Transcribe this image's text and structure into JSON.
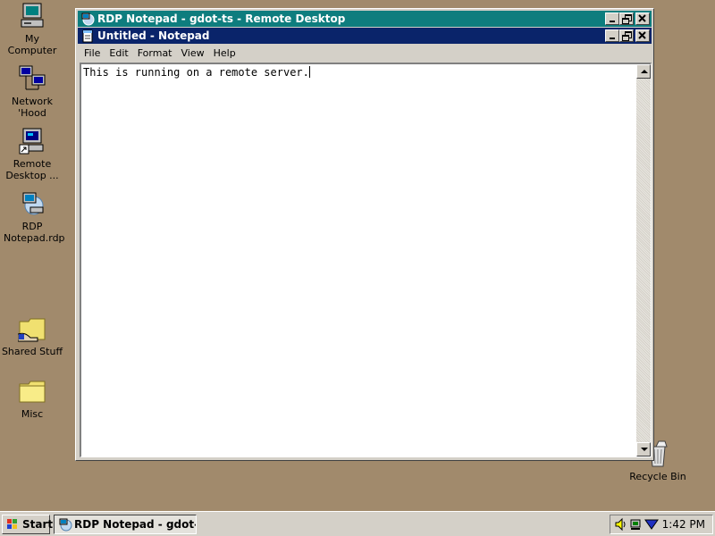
{
  "desktop": {
    "icons": [
      {
        "label": "My Computer",
        "icon": "computer-icon"
      },
      {
        "label": "Network 'Hood",
        "icon": "network-icon"
      },
      {
        "label": "Remote Desktop ...",
        "icon": "remote-desktop-icon"
      },
      {
        "label": "RDP Notepad.rdp",
        "icon": "rdp-file-icon"
      },
      {
        "label": "Shared Stuff",
        "icon": "shared-folder-icon"
      },
      {
        "label": "Misc",
        "icon": "folder-icon"
      },
      {
        "label": "Recycle Bin",
        "icon": "recycle-bin-icon"
      }
    ]
  },
  "rdp_window": {
    "title": "RDP Notepad - gdot-ts - Remote Desktop"
  },
  "notepad": {
    "title": "Untitled - Notepad",
    "menu": [
      "File",
      "Edit",
      "Format",
      "View",
      "Help"
    ],
    "content": "This is running on a remote server."
  },
  "taskbar": {
    "start_label": "Start",
    "task_label": "RDP Notepad - gdot-t...",
    "clock": "1:42 PM"
  },
  "colors": {
    "desktop": "#a18a6c",
    "rdp_titlebar": "#0e7d7e",
    "notepad_titlebar": "#0a246a"
  }
}
